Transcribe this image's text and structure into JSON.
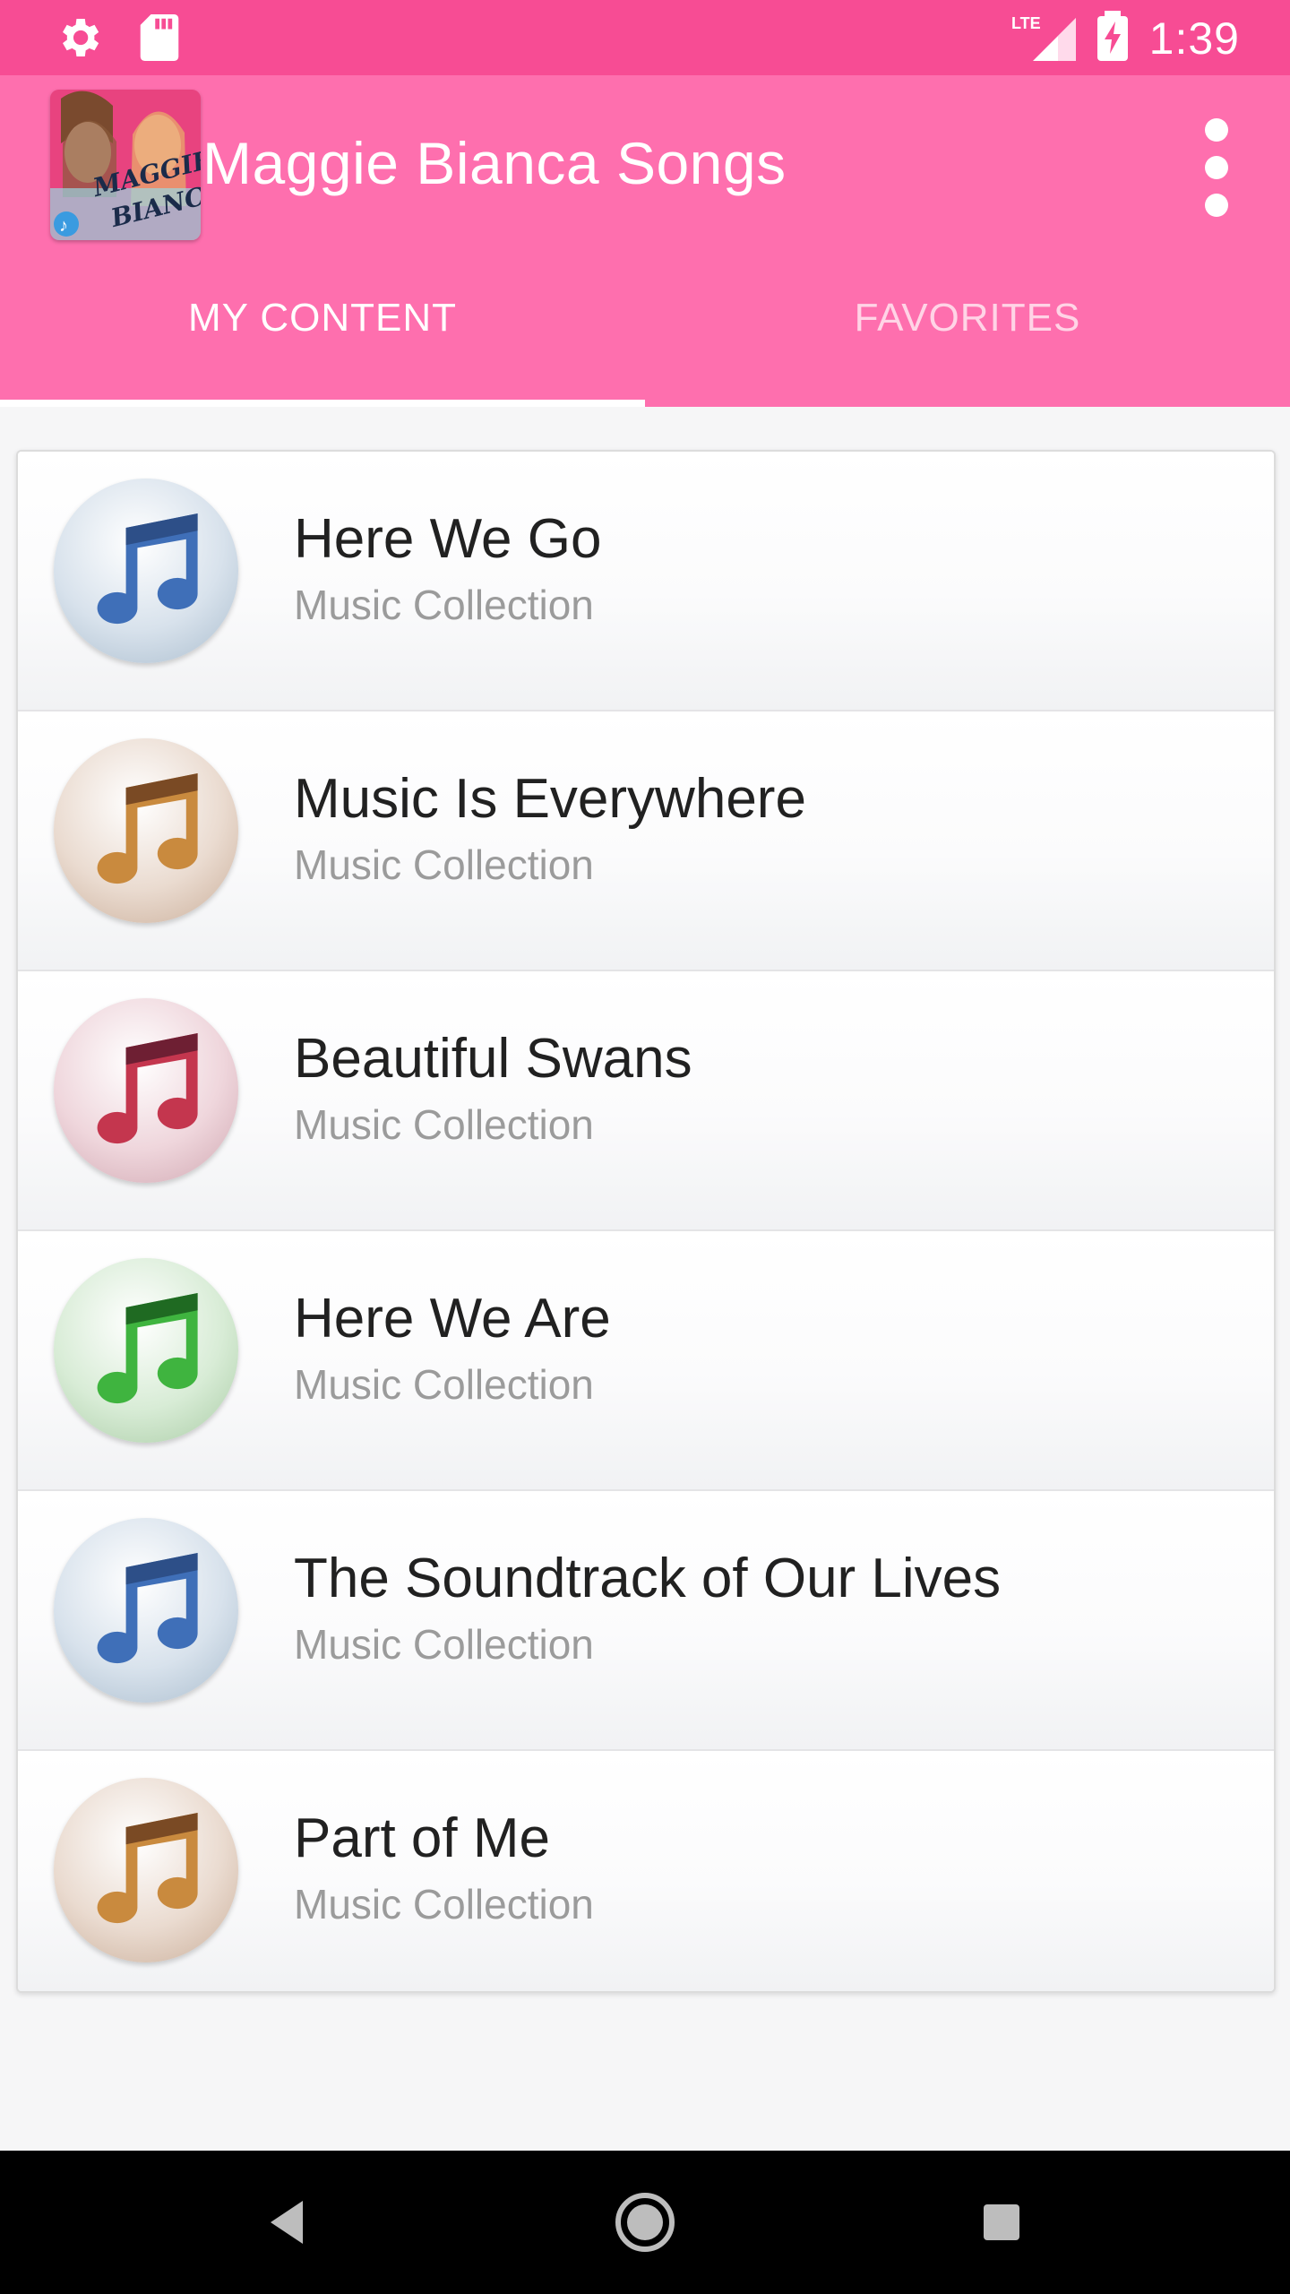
{
  "status_bar": {
    "time": "1:39",
    "network": "LTE",
    "icons": [
      "gear-icon",
      "sd-card-icon",
      "lte-signal-icon",
      "battery-charging-icon"
    ]
  },
  "app_bar": {
    "title": "Maggie Bianca Songs",
    "icon_text": "MAGGIE BIANCA",
    "menu_icon": "more-vertical-icon",
    "color": "#fe6fae",
    "status_color": "#f74c94"
  },
  "tabs": [
    {
      "label": "MY CONTENT",
      "active": true
    },
    {
      "label": "FAVORITES",
      "active": false
    }
  ],
  "songs": [
    {
      "title": "Here We Go",
      "subtitle": "Music Collection",
      "icon": "music-note-icon",
      "color": "blue"
    },
    {
      "title": "Music Is Everywhere",
      "subtitle": "Music Collection",
      "icon": "music-note-icon",
      "color": "brown"
    },
    {
      "title": "Beautiful Swans",
      "subtitle": "Music Collection",
      "icon": "music-note-icon",
      "color": "red"
    },
    {
      "title": "Here We Are",
      "subtitle": "Music Collection",
      "icon": "music-note-icon",
      "color": "green"
    },
    {
      "title": "The Soundtrack of Our Lives",
      "subtitle": "Music Collection",
      "icon": "music-note-icon",
      "color": "blue"
    },
    {
      "title": "Part of Me",
      "subtitle": "Music Collection",
      "icon": "music-note-icon",
      "color": "brown"
    }
  ],
  "nav_bar": {
    "buttons": [
      "back-icon",
      "home-icon",
      "recents-icon"
    ]
  }
}
